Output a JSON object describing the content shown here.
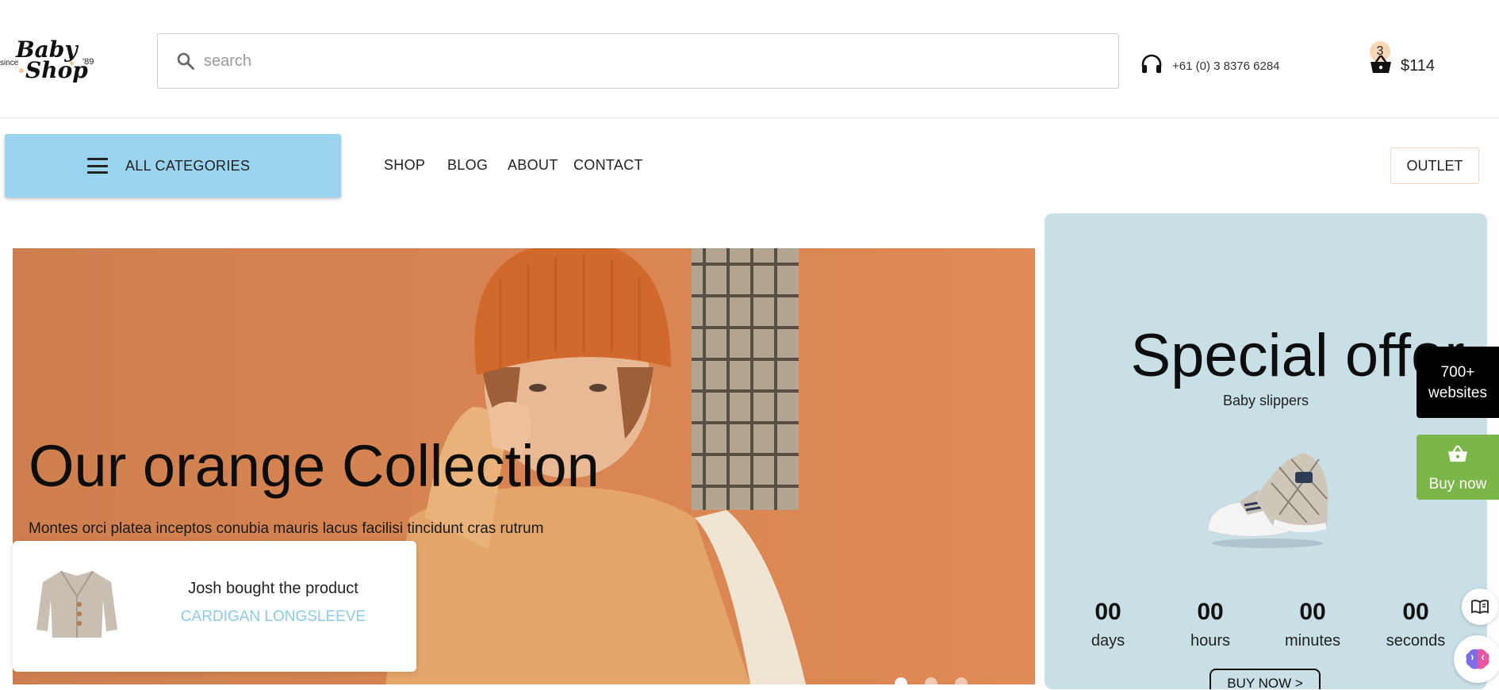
{
  "logo": {
    "since": "since",
    "word1": "Baby",
    "word2": "Shop",
    "year": "'89"
  },
  "search": {
    "placeholder": "search"
  },
  "phone": {
    "number": "+61 (0) 3 8376 6284"
  },
  "cart": {
    "count": "3",
    "total": "$114"
  },
  "nav": {
    "categories_label": "ALL CATEGORIES",
    "items": [
      "SHOP",
      "BLOG",
      "ABOUT",
      "CONTACT"
    ],
    "outlet_label": "OUTLET"
  },
  "hero": {
    "title": "Our orange Collection",
    "subtitle": "Montes orci platea inceptos conubia mauris lacus facilisi tincidunt cras rutrum",
    "slides": 3,
    "active_slide": 1
  },
  "toast": {
    "message": "Josh bought the product",
    "product": "CARDIGAN LONGSLEEVE"
  },
  "offer": {
    "title": "Special offer",
    "subtitle": "Baby slippers",
    "countdown": [
      {
        "value": "00",
        "unit": "days"
      },
      {
        "value": "00",
        "unit": "hours"
      },
      {
        "value": "00",
        "unit": "minutes"
      },
      {
        "value": "00",
        "unit": "seconds"
      }
    ],
    "button_label": "BUY NOW >"
  },
  "widgets": {
    "sites_line1": "700+",
    "sites_line2": "websites",
    "buy_now": "Buy now"
  },
  "colors": {
    "categories_bg": "#9ad4ee",
    "hero_bg": "#d88655",
    "offer_bg": "#c8dfe6",
    "buy_widget": "#7ab648",
    "product_link": "#8ccbe8"
  }
}
